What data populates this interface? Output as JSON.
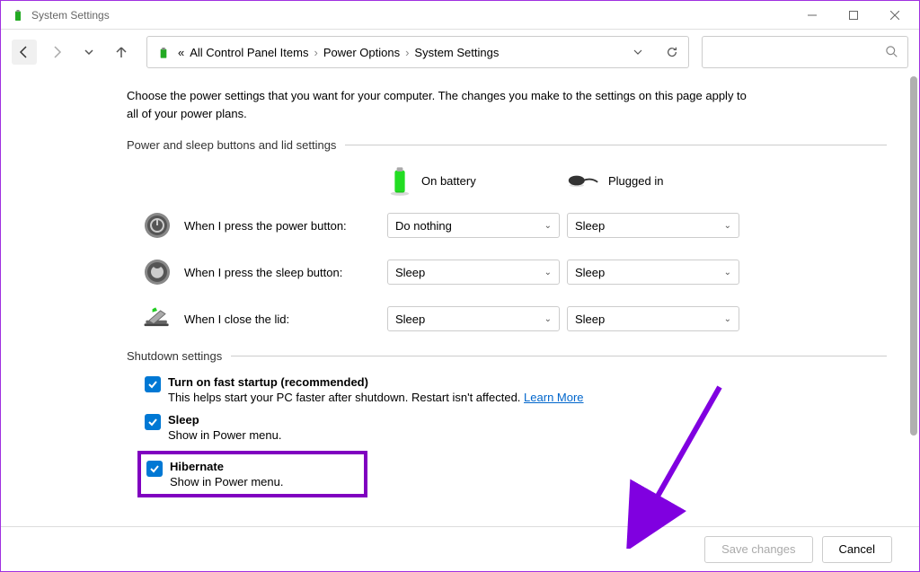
{
  "window": {
    "title": "System Settings"
  },
  "breadcrumb": {
    "prefix": "«",
    "items": [
      "All Control Panel Items",
      "Power Options",
      "System Settings"
    ]
  },
  "intro": "Choose the power settings that you want for your computer. The changes you make to the settings on this page apply to all of your power plans.",
  "sections": {
    "buttons_lid": "Power and sleep buttons and lid settings",
    "shutdown": "Shutdown settings"
  },
  "modes": {
    "battery": "On battery",
    "plugged": "Plugged in"
  },
  "rows": {
    "power_button": {
      "label": "When I press the power button:",
      "battery": "Do nothing",
      "plugged": "Sleep"
    },
    "sleep_button": {
      "label": "When I press the sleep button:",
      "battery": "Sleep",
      "plugged": "Sleep"
    },
    "close_lid": {
      "label": "When I close the lid:",
      "battery": "Sleep",
      "plugged": "Sleep"
    }
  },
  "shutdown_opts": {
    "fast_startup": {
      "title": "Turn on fast startup (recommended)",
      "desc": "This helps start your PC faster after shutdown. Restart isn't affected.",
      "link": "Learn More"
    },
    "sleep": {
      "title": "Sleep",
      "desc": "Show in Power menu."
    },
    "hibernate": {
      "title": "Hibernate",
      "desc": "Show in Power menu."
    }
  },
  "footer": {
    "save": "Save changes",
    "cancel": "Cancel"
  }
}
